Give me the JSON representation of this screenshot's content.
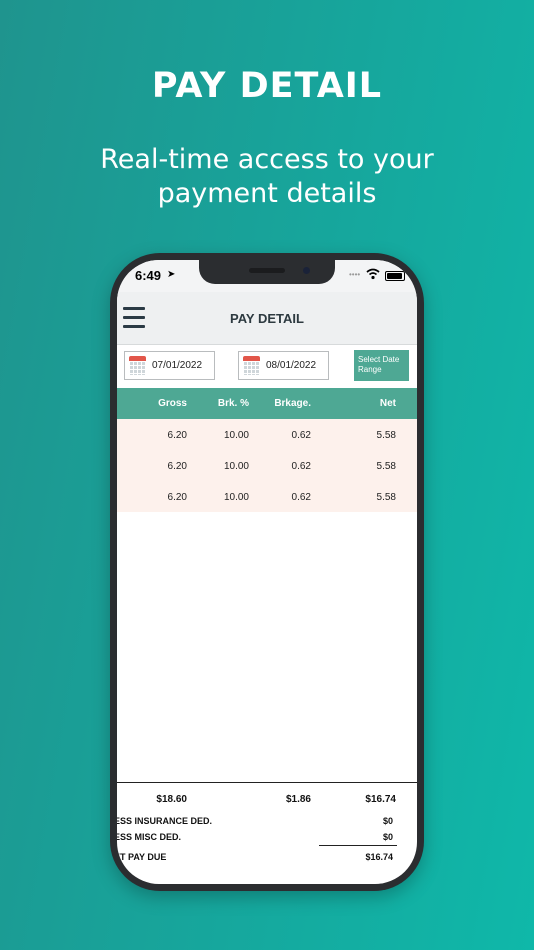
{
  "promo": {
    "title": "PAY DETAIL",
    "subtitle": "Real-time access to your payment details"
  },
  "status_bar": {
    "time": "6:49"
  },
  "header": {
    "title": "PAY DETAIL"
  },
  "filters": {
    "start_date": "07/01/2022",
    "end_date": "08/01/2022",
    "range_button": "Select Date Range"
  },
  "table": {
    "columns": [
      "Gross",
      "Brk. %",
      "Brkage.",
      "Net"
    ],
    "rows": [
      [
        "6.20",
        "10.00",
        "0.62",
        "5.58"
      ],
      [
        "6.20",
        "10.00",
        "0.62",
        "5.58"
      ],
      [
        "6.20",
        "10.00",
        "0.62",
        "5.58"
      ]
    ]
  },
  "totals": {
    "gross": "$18.60",
    "brkage": "$1.86",
    "net": "$16.74"
  },
  "deductions": [
    {
      "label": "ESS INSURANCE DED.",
      "value": "$0"
    },
    {
      "label": "ESS MISC DED.",
      "value": "$0"
    }
  ],
  "net_pay": {
    "label": "ET PAY DUE",
    "value": "$16.74"
  },
  "colors": {
    "accent": "#4ea894",
    "row_bg": "#fdf1ec",
    "background": "#16a79d"
  }
}
